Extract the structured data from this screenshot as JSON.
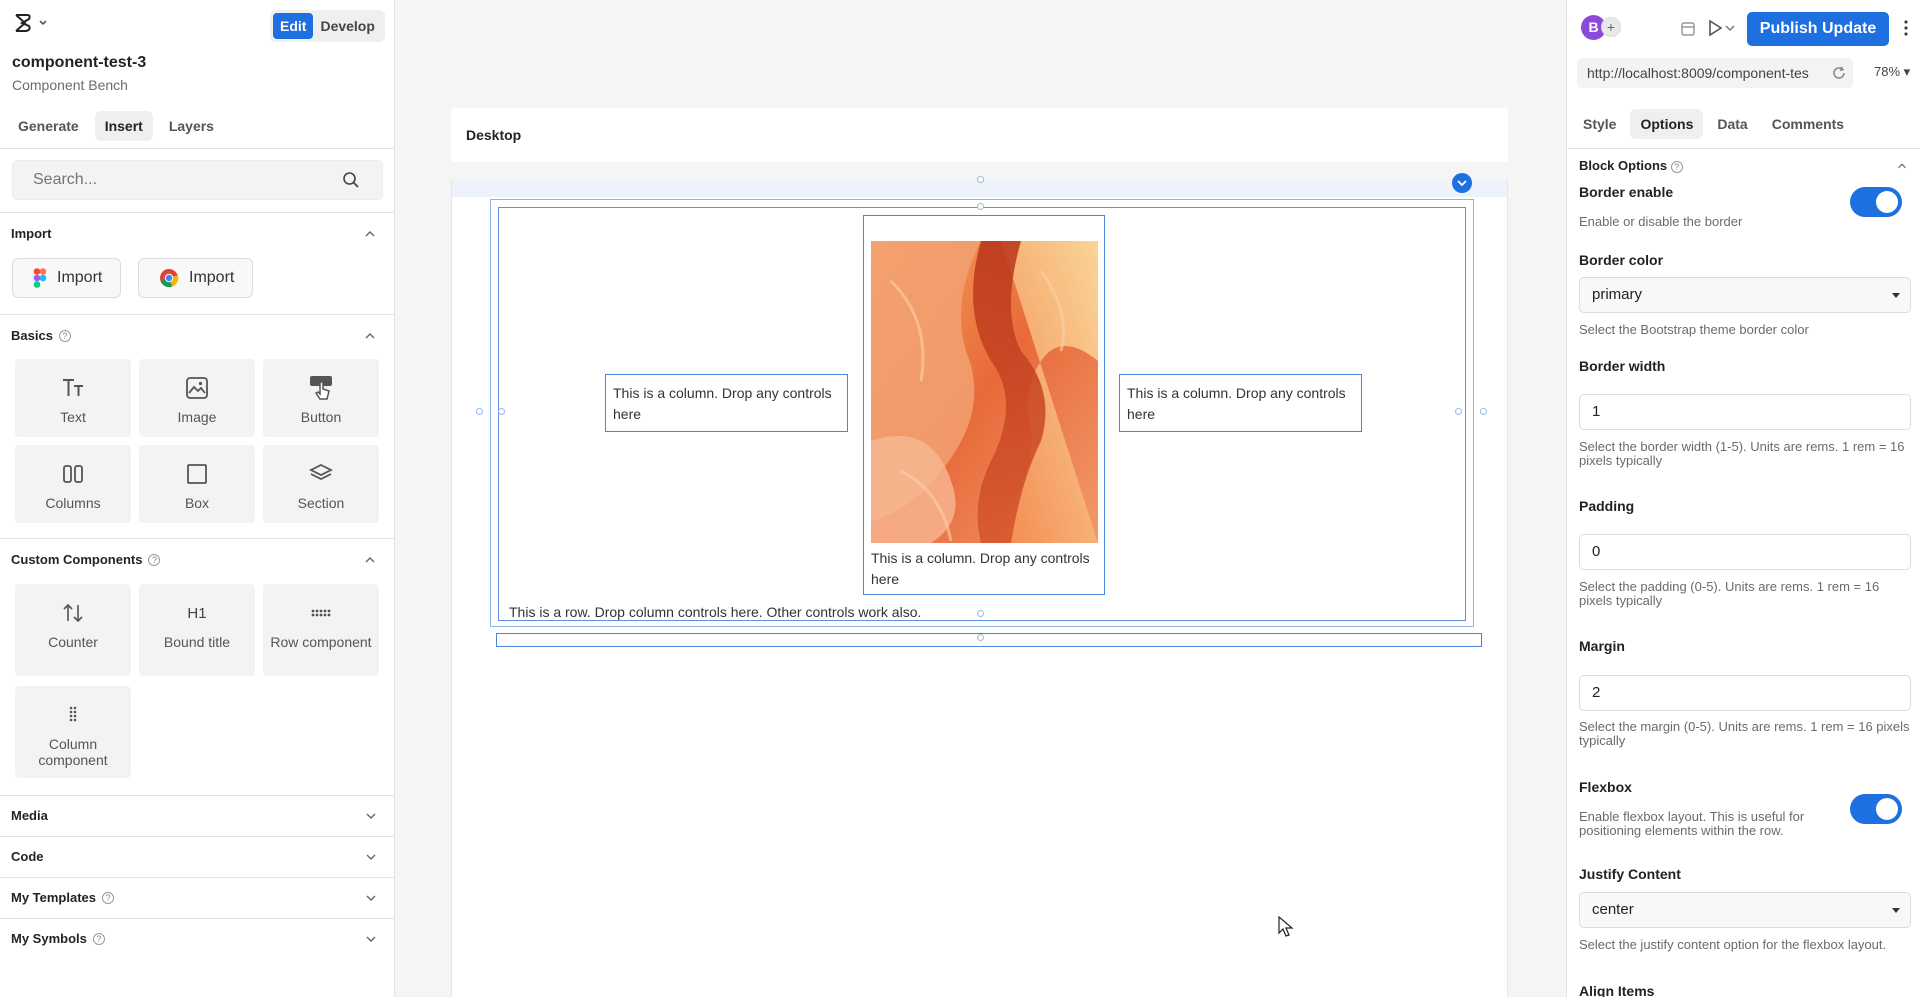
{
  "left": {
    "mode": {
      "edit": "Edit",
      "develop": "Develop"
    },
    "project": {
      "title": "component-test-3",
      "subtitle": "Component Bench"
    },
    "tabs": [
      "Generate",
      "Insert",
      "Layers"
    ],
    "search": {
      "placeholder": "Search..."
    },
    "import": {
      "title": "Import",
      "figma_label": "Import",
      "chrome_label": "Import"
    },
    "basics": {
      "title": "Basics",
      "items": [
        "Text",
        "Image",
        "Button",
        "Columns",
        "Box",
        "Section"
      ]
    },
    "custom": {
      "title": "Custom Components",
      "items": [
        "Counter",
        "Bound title",
        "Row component",
        "Column component"
      ],
      "bound_title_glyph": "H1"
    },
    "collapsed": [
      "Media",
      "Code",
      "My Templates",
      "My Symbols"
    ]
  },
  "canvas": {
    "device": "Desktop",
    "columns": {
      "left": "This is a column. Drop any controls here",
      "middle": "This is a column. Drop any controls here",
      "right": "This is a column. Drop any controls here"
    },
    "row_note": "This is a row. Drop column controls here. Other controls work also."
  },
  "right": {
    "avatar": "B",
    "avatar_plus": "+",
    "publish": "Publish Update",
    "url": "http://localhost:8009/component-tes",
    "zoom": "78%",
    "tabs": [
      "Style",
      "Options",
      "Data",
      "Comments"
    ],
    "block_options": "Block Options",
    "border_enable": {
      "label": "Border enable",
      "help": "Enable or disable the border",
      "on": true
    },
    "border_color": {
      "label": "Border color",
      "value": "primary",
      "help": "Select the Bootstrap theme border color"
    },
    "border_width": {
      "label": "Border width",
      "value": "1",
      "help": "Select the border width (1-5). Units are rems. 1 rem = 16 pixels typically"
    },
    "padding": {
      "label": "Padding",
      "value": "0",
      "help": "Select the padding (0-5). Units are rems. 1 rem = 16 pixels typically"
    },
    "margin": {
      "label": "Margin",
      "value": "2",
      "help": "Select the margin (0-5). Units are rems. 1 rem = 16 pixels typically"
    },
    "flexbox": {
      "label": "Flexbox",
      "help": "Enable flexbox layout. This is useful for positioning elements within the row.",
      "on": true
    },
    "justify": {
      "label": "Justify Content",
      "value": "center",
      "help": "Select the justify content option for the flexbox layout."
    },
    "align": {
      "label": "Align Items"
    }
  },
  "colors": {
    "accent": "#1e6fe0",
    "selection": "#4a86da"
  }
}
